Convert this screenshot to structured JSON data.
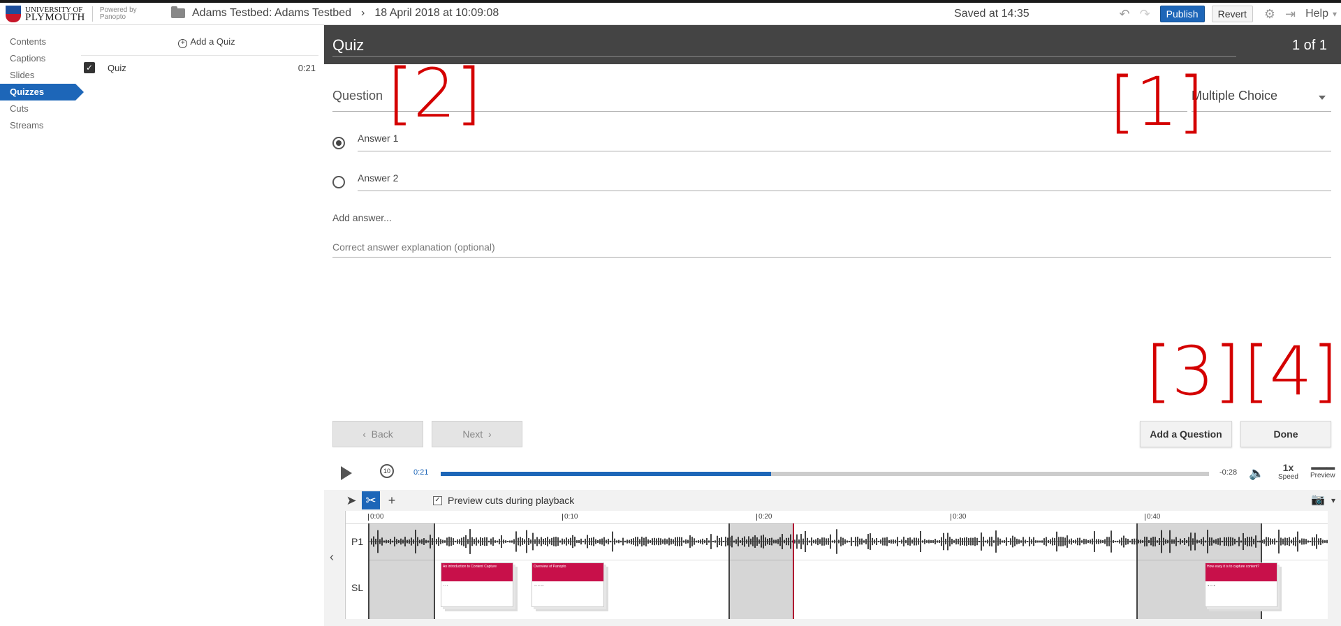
{
  "topbar": {
    "university_line1": "UNIVERSITY OF",
    "university_line2": "PLYMOUTH",
    "powered_by": "Powered by",
    "powered_brand": "Panopto",
    "breadcrumb_folder": "Adams Testbed: Adams Testbed",
    "breadcrumb_session": "18 April 2018 at 10:09:08",
    "saved_status": "Saved at 14:35",
    "publish_label": "Publish",
    "revert_label": "Revert",
    "help_label": "Help",
    "icons": [
      "folder-icon",
      "chevron-right-icon",
      "undo-icon",
      "redo-icon",
      "gear-icon",
      "exit-icon",
      "chevron-down-icon"
    ]
  },
  "sidebar": {
    "items": [
      {
        "label": "Contents",
        "active": false
      },
      {
        "label": "Captions",
        "active": false
      },
      {
        "label": "Slides",
        "active": false
      },
      {
        "label": "Quizzes",
        "active": true
      },
      {
        "label": "Cuts",
        "active": false
      },
      {
        "label": "Streams",
        "active": false
      }
    ]
  },
  "quiz_list": {
    "add_label": "Add a Quiz",
    "items": [
      {
        "label": "Quiz",
        "time": "0:21"
      }
    ]
  },
  "editor": {
    "title": "Quiz",
    "count": "1 of 1",
    "question_placeholder": "Question",
    "question_type": "Multiple Choice",
    "answers": [
      {
        "label": "Answer 1",
        "selected": true
      },
      {
        "label": "Answer 2",
        "selected": false
      }
    ],
    "add_answer": "Add answer...",
    "explanation_placeholder": "Correct answer explanation (optional)",
    "back_label": "Back",
    "next_label": "Next",
    "add_question_label": "Add a Question",
    "done_label": "Done",
    "annotations": [
      "[1]",
      "[2]",
      "[3]",
      "[4]"
    ]
  },
  "player": {
    "current_time": "0:21",
    "remaining_time": "-0:28",
    "progress": 0.43,
    "speed_value": "1x",
    "speed_label": "Speed",
    "preview_label": "Preview",
    "rewind_label": "10"
  },
  "timeline": {
    "preview_cuts_label": "Preview cuts during playback",
    "preview_cuts_checked": true,
    "ticks": [
      "0:00",
      "0:10",
      "0:20",
      "0:30",
      "0:40"
    ],
    "row_labels": [
      "P1",
      "SL"
    ],
    "slide_titles": [
      "An introduction to Content Capture",
      "Overview of Panopto",
      "How easy it is to capture content?"
    ]
  },
  "colors": {
    "accent": "#1d66b8",
    "header_bg": "#444444",
    "annotation": "#d40000",
    "slide_header": "#c8104a"
  }
}
